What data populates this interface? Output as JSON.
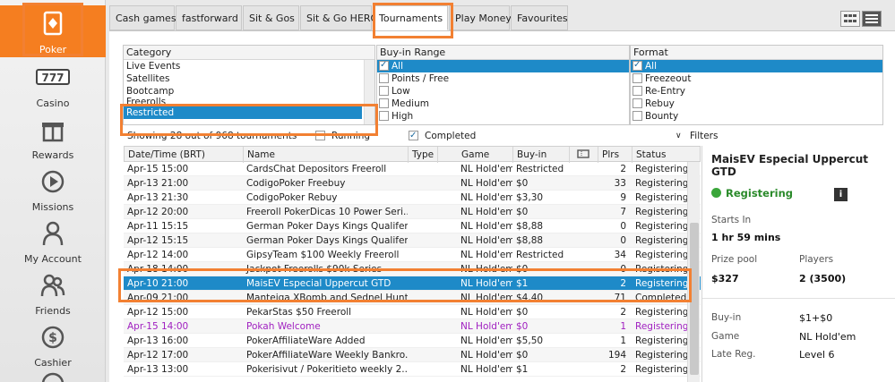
{
  "sidebar": {
    "items": [
      {
        "label": "Poker",
        "icon": "poker-card-icon"
      },
      {
        "label": "Casino",
        "icon": "slot-777-icon"
      },
      {
        "label": "Rewards",
        "icon": "gift-icon"
      },
      {
        "label": "Missions",
        "icon": "play-circle-icon"
      },
      {
        "label": "My Account",
        "icon": "person-icon"
      },
      {
        "label": "Friends",
        "icon": "friends-icon"
      },
      {
        "label": "Cashier",
        "icon": "dollar-coin-icon"
      }
    ]
  },
  "tabs": [
    "Cash games",
    "fastforward",
    "Sit & Gos",
    "Sit & Go HERO",
    "Tournaments",
    "Play Money",
    "Favourites"
  ],
  "active_tab": "Tournaments",
  "filters": {
    "category": {
      "header": "Category",
      "items": [
        "Live Events",
        "Satellites",
        "Bootcamp",
        "Freerolls",
        "Restricted"
      ],
      "selected": "Restricted"
    },
    "buyin": {
      "header": "Buy-in Range",
      "items": [
        "All",
        "Points / Free",
        "Low",
        "Medium",
        "High"
      ],
      "checked": [
        "All"
      ]
    },
    "format": {
      "header": "Format",
      "items": [
        "All",
        "Freezeout",
        "Re-Entry",
        "Rebuy",
        "Bounty"
      ],
      "checked": [
        "All"
      ]
    }
  },
  "status_bar": {
    "showing": "Showing 28 out of 968 tournaments",
    "running": "Running",
    "completed": "Completed",
    "filters": "Filters"
  },
  "table": {
    "columns": [
      "Date/Time (BRT)",
      "Name",
      "Type",
      "Game",
      "Buy-in",
      "",
      "Plrs",
      "Status"
    ],
    "rows": [
      {
        "date": "Apr-15 15:00",
        "name": "CardsChat Depositors Freeroll",
        "type": "",
        "game": "NL Hold'em",
        "buyin": "Restricted",
        "plrs": "2",
        "status": "Registering"
      },
      {
        "date": "Apr-13 21:00",
        "name": "CodigoPoker Freebuy",
        "type": "",
        "game": "NL Hold'em",
        "buyin": "$0",
        "plrs": "33",
        "status": "Registering"
      },
      {
        "date": "Apr-13 21:30",
        "name": "CodigoPoker Rebuy",
        "type": "",
        "game": "NL Hold'em",
        "buyin": "$3,30",
        "plrs": "9",
        "status": "Registering"
      },
      {
        "date": "Apr-12 20:00",
        "name": "Freeroll PokerDicas 10 Power Seri...",
        "type": "",
        "game": "NL Hold'em",
        "buyin": "$0",
        "plrs": "7",
        "status": "Registering"
      },
      {
        "date": "Apr-11 15:15",
        "name": "German Poker Days Kings Qualifer",
        "type": "",
        "game": "NL Hold'em",
        "buyin": "$8,88",
        "plrs": "0",
        "status": "Registering"
      },
      {
        "date": "Apr-12 15:15",
        "name": "German Poker Days Kings Qualifer",
        "type": "",
        "game": "NL Hold'em",
        "buyin": "$8,88",
        "plrs": "0",
        "status": "Registering"
      },
      {
        "date": "Apr-12 14:00",
        "name": "GipsyTeam $100 Weekly Freeroll",
        "type": "",
        "game": "NL Hold'em",
        "buyin": "Restricted",
        "plrs": "34",
        "status": "Registering"
      },
      {
        "date": "Apr-18 14:00",
        "name": "Jackpot Freerolls $90k Series",
        "type": "",
        "game": "NL Hold'em",
        "buyin": "$0",
        "plrs": "0",
        "status": "Registering"
      },
      {
        "date": "Apr-10 21:00",
        "name": "MaisEV Especial Uppercut GTD",
        "type": "",
        "game": "NL Hold'em",
        "buyin": "$1",
        "plrs": "2",
        "status": "Registering"
      },
      {
        "date": "Apr-09 21:00",
        "name": "Manteiga XBomb and Sednel Hunt...",
        "type": "",
        "game": "NL Hold'em",
        "buyin": "$4,40",
        "plrs": "71",
        "status": "Completed"
      },
      {
        "date": "Apr-12 15:00",
        "name": "PekarStas $50 Freeroll",
        "type": "",
        "game": "NL Hold'em",
        "buyin": "$0",
        "plrs": "2",
        "status": "Registering"
      },
      {
        "date": "Apr-15 14:00",
        "name": "Pokah Welcome",
        "type": "",
        "game": "NL Hold'em",
        "buyin": "$0",
        "plrs": "1",
        "status": "Registering"
      },
      {
        "date": "Apr-13 16:00",
        "name": "PokerAffiliateWare Added",
        "type": "",
        "game": "NL Hold'em",
        "buyin": "$5,50",
        "plrs": "1",
        "status": "Registering"
      },
      {
        "date": "Apr-12 17:00",
        "name": "PokerAffiliateWare Weekly Bankro...",
        "type": "",
        "game": "NL Hold'em",
        "buyin": "$0",
        "plrs": "194",
        "status": "Registering"
      },
      {
        "date": "Apr-13 13:00",
        "name": "Pokerisivut / Pokeritieto weekly 2...",
        "type": "",
        "game": "NL Hold'em",
        "buyin": "$1",
        "plrs": "2",
        "status": "Registering"
      }
    ],
    "selected_index": 8,
    "purple_index": 11
  },
  "details": {
    "title": "MaisEV Especial Uppercut GTD",
    "status": "Registering",
    "info_icon": "i",
    "starts_in_label": "Starts In",
    "starts_in_value": "1 hr  59 mins",
    "prize_pool_label": "Prize pool",
    "prize_pool_value": "$327",
    "players_label": "Players",
    "players_value": "2 (3500)",
    "buyin_label": "Buy-in",
    "buyin_value": "$1+$0",
    "game_label": "Game",
    "game_value": "NL Hold'em",
    "late_reg_label": "Late Reg.",
    "late_reg_value": "Level 6"
  },
  "colors": {
    "accent": "#f57e20",
    "highlight_border": "#f28032",
    "selection": "#1e8ac8",
    "registering_green": "#2a8a2a",
    "purple_row": "#a020c0"
  }
}
